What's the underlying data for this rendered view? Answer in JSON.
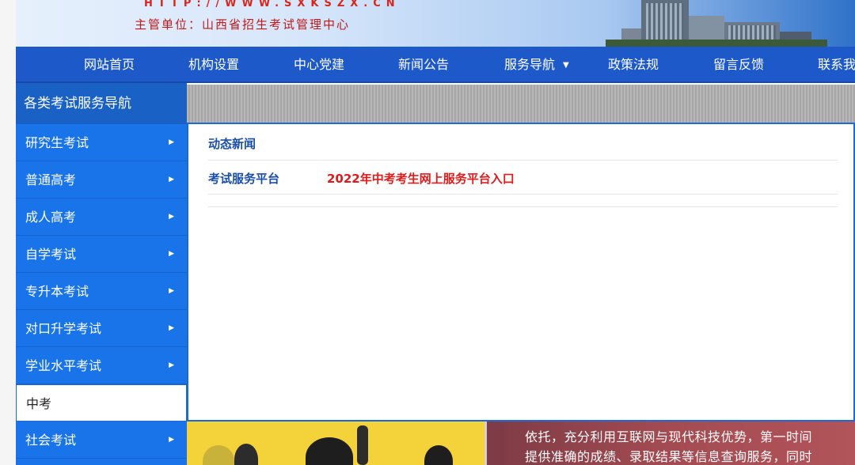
{
  "header": {
    "url_text": "HTTP://WWW.SXKSZX.CN",
    "sponsor_text": "主管单位：山西省招生考试管理中心"
  },
  "nav": {
    "items": [
      {
        "label": "网站首页"
      },
      {
        "label": "机构设置"
      },
      {
        "label": "中心党建"
      },
      {
        "label": "新闻公告"
      },
      {
        "label": "服务导航",
        "dropdown": true
      },
      {
        "label": "政策法规"
      },
      {
        "label": "留言反馈"
      },
      {
        "label": "联系我"
      }
    ],
    "caret_icon": "▼"
  },
  "sidebar": {
    "title": "各类考试服务导航",
    "arrow_icon": "▶",
    "items": [
      {
        "label": "研究生考试"
      },
      {
        "label": "普通高考"
      },
      {
        "label": "成人高考"
      },
      {
        "label": "自学考试"
      },
      {
        "label": "专升本考试"
      },
      {
        "label": "对口升学考试"
      },
      {
        "label": "学业水平考试"
      },
      {
        "label": "中考",
        "active": true
      },
      {
        "label": "社会考试"
      }
    ]
  },
  "panel": {
    "rows": [
      {
        "category": "动态新闻",
        "link": ""
      },
      {
        "category": "考试服务平台",
        "link": "2022年中考考生网上服务平台入口"
      }
    ]
  },
  "bottom_text": {
    "line1": "依托，充分利用互联网与现代科技优势，第一时间",
    "line2": "提供准确的成绩、录取结果等信息查询服务，同时"
  },
  "colors": {
    "nav_bg": "#1e59c9",
    "sidebar_item_bg": "#1974ea",
    "link_red": "#e11b1b",
    "category_blue": "#1a4ea8"
  }
}
